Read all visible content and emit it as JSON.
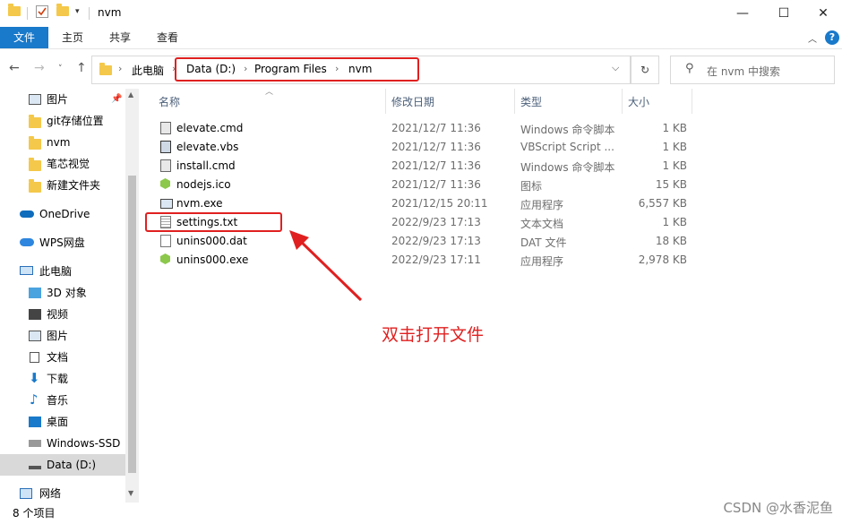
{
  "window": {
    "title": "nvm",
    "controls": {
      "minimize": "—",
      "maximize": "☐",
      "close": "✕"
    }
  },
  "ribbon": {
    "tabs": [
      {
        "label": "文件",
        "active": true
      },
      {
        "label": "主页",
        "active": false
      },
      {
        "label": "共享",
        "active": false
      },
      {
        "label": "查看",
        "active": false
      }
    ]
  },
  "address": {
    "this_pc": "此电脑",
    "crumbs": [
      "Data (D:)",
      "Program Files",
      "nvm"
    ],
    "search_placeholder": "在 nvm 中搜索"
  },
  "sidebar": {
    "items": [
      {
        "label": "图片",
        "icon": "pictures-icon",
        "pinned": true
      },
      {
        "label": "git存储位置",
        "icon": "folder-icon"
      },
      {
        "label": "nvm",
        "icon": "folder-icon"
      },
      {
        "label": "笔芯视觉",
        "icon": "folder-icon"
      },
      {
        "label": "新建文件夹",
        "icon": "folder-icon"
      },
      {
        "label": "OneDrive",
        "icon": "onedrive-icon"
      },
      {
        "label": "WPS网盘",
        "icon": "wps-cloud-icon"
      },
      {
        "label": "此电脑",
        "icon": "this-pc-icon"
      },
      {
        "label": "3D 对象",
        "icon": "3d-objects-icon"
      },
      {
        "label": "视频",
        "icon": "video-icon"
      },
      {
        "label": "图片",
        "icon": "pictures-icon"
      },
      {
        "label": "文档",
        "icon": "documents-icon"
      },
      {
        "label": "下载",
        "icon": "download-icon"
      },
      {
        "label": "音乐",
        "icon": "music-icon"
      },
      {
        "label": "桌面",
        "icon": "desktop-icon"
      },
      {
        "label": "Windows-SSD",
        "icon": "drive-icon"
      },
      {
        "label": "Data (D:)",
        "icon": "drive-icon",
        "selected": true
      },
      {
        "label": "网络",
        "icon": "network-icon"
      }
    ]
  },
  "columns": {
    "name": "名称",
    "date": "修改日期",
    "type": "类型",
    "size": "大小"
  },
  "files": [
    {
      "name": "elevate.cmd",
      "date": "2021/12/7 11:36",
      "type": "Windows 命令脚本",
      "size": "1 KB",
      "icon": "cmd-file-icon"
    },
    {
      "name": "elevate.vbs",
      "date": "2021/12/7 11:36",
      "type": "VBScript Script ...",
      "size": "1 KB",
      "icon": "vbs-file-icon"
    },
    {
      "name": "install.cmd",
      "date": "2021/12/7 11:36",
      "type": "Windows 命令脚本",
      "size": "1 KB",
      "icon": "cmd-file-icon"
    },
    {
      "name": "nodejs.ico",
      "date": "2021/12/7 11:36",
      "type": "图标",
      "size": "15 KB",
      "icon": "nodejs-icon"
    },
    {
      "name": "nvm.exe",
      "date": "2021/12/15 20:11",
      "type": "应用程序",
      "size": "6,557 KB",
      "icon": "exe-file-icon"
    },
    {
      "name": "settings.txt",
      "date": "2022/9/23 17:13",
      "type": "文本文档",
      "size": "1 KB",
      "icon": "text-file-icon"
    },
    {
      "name": "unins000.dat",
      "date": "2022/9/23 17:13",
      "type": "DAT 文件",
      "size": "18 KB",
      "icon": "generic-file-icon"
    },
    {
      "name": "unins000.exe",
      "date": "2022/9/23 17:11",
      "type": "应用程序",
      "size": "2,978 KB",
      "icon": "nodejs-icon"
    }
  ],
  "annotation": "双击打开文件",
  "status": {
    "count": "8 个项目"
  },
  "watermark": "CSDN @水香泥鱼",
  "colors": {
    "accent": "#1979ca",
    "annotation": "#e02020",
    "folder": "#f4c84a"
  }
}
